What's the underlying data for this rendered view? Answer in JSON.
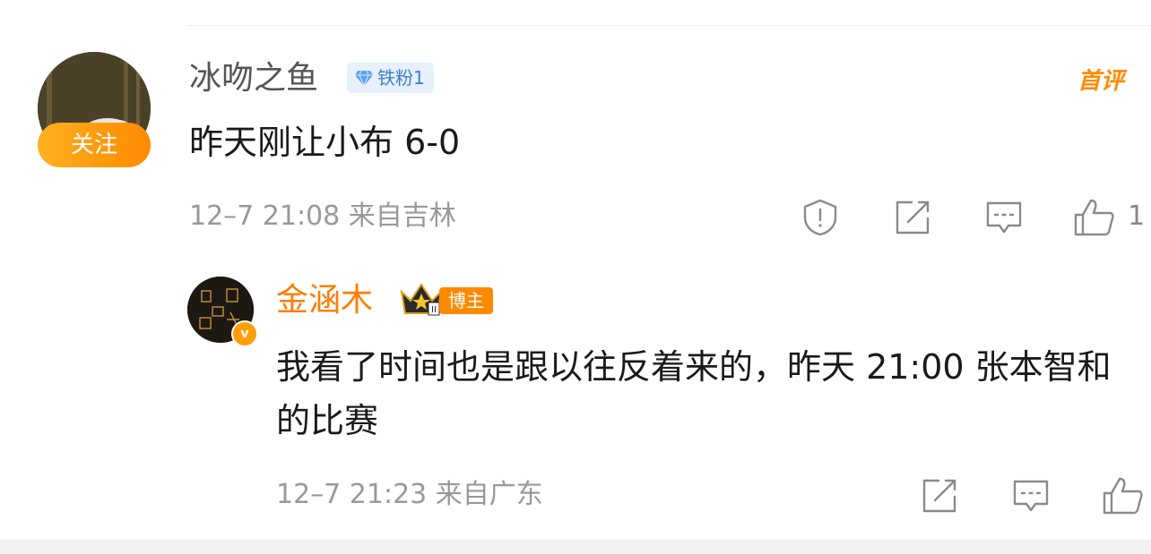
{
  "comment": {
    "follow_label": "关注",
    "username": "冰吻之鱼",
    "fan_badge": "铁粉1",
    "first_badge": "首评",
    "content": "昨天刚让小布 6-0",
    "meta": "12–7 21:08 来自吉林",
    "like_count": "1"
  },
  "reply": {
    "username": "金涵木",
    "badge": "博主",
    "content": "我看了时间也是跟以往反着来的，昨天 21:00 张本智和的比赛",
    "meta": "12–7 21:23 来自广东",
    "verified_mark": "v",
    "crown_rank": "II"
  },
  "icons": {
    "report": "report-icon",
    "share": "share-icon",
    "comment": "comment-icon",
    "like": "like-icon",
    "diamond": "diamond-icon",
    "crown": "crown-icon"
  },
  "colors": {
    "accent_orange": "#ff8a00",
    "badge_blue": "#3d7fd1",
    "meta_gray": "#999999"
  }
}
